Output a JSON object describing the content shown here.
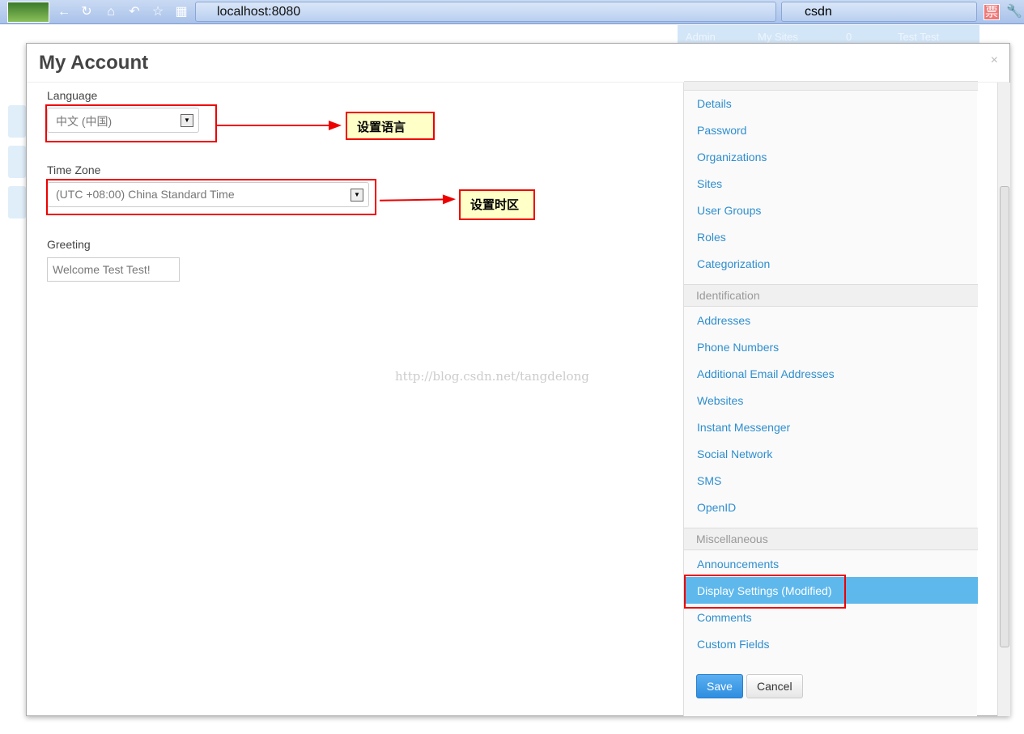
{
  "browser": {
    "url": "localhost:8080",
    "search": "csdn"
  },
  "topbar": {
    "items": [
      "Admin",
      "My Sites",
      "0",
      "Test Test"
    ]
  },
  "modal": {
    "title": "My Account",
    "close": "×"
  },
  "form": {
    "language_label": "Language",
    "language_value": "中文 (中国)",
    "timezone_label": "Time Zone",
    "timezone_value": "(UTC +08:00) China Standard Time",
    "greeting_label": "Greeting",
    "greeting_value": "Welcome Test Test!"
  },
  "annotations": {
    "language": "设置语言",
    "timezone": "设置时区"
  },
  "watermark": "http://blog.csdn.net/tangdelong",
  "sidebar": {
    "user_items": [
      "Details",
      "Password",
      "Organizations",
      "Sites",
      "User Groups",
      "Roles",
      "Categorization"
    ],
    "identification_header": "Identification",
    "identification_items": [
      "Addresses",
      "Phone Numbers",
      "Additional Email Addresses",
      "Websites",
      "Instant Messenger",
      "Social Network",
      "SMS",
      "OpenID"
    ],
    "misc_header": "Miscellaneous",
    "misc_items": [
      "Announcements",
      "Display Settings (Modified)",
      "Comments",
      "Custom Fields"
    ],
    "active_item": "Display Settings (Modified)"
  },
  "buttons": {
    "save": "Save",
    "cancel": "Cancel"
  },
  "colors": {
    "link": "#2e8ece",
    "active": "#5eb8ec",
    "annotation": "#ee0000",
    "save": "#3f9de8"
  }
}
